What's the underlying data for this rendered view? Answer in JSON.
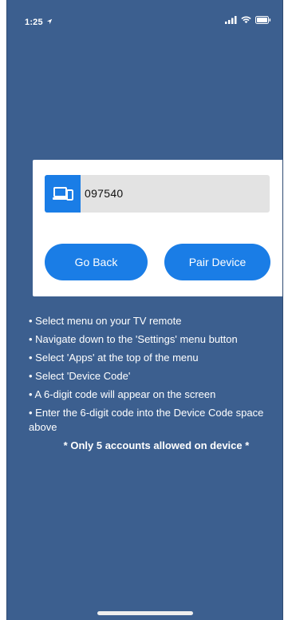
{
  "status_bar": {
    "time": "1:25",
    "location_icon": "location-arrow-icon",
    "signal_icon": "signal-bars-icon",
    "wifi_icon": "wifi-icon",
    "battery_icon": "battery-icon"
  },
  "pair_card": {
    "device_icon": "tv-device-icon",
    "device_code": "097540",
    "back_label": "Go Back",
    "pair_label": "Pair Device"
  },
  "instructions": {
    "items": [
      "• Select menu on your TV remote",
      "• Navigate down to the 'Settings' menu button",
      "• Select 'Apps' at the top of the menu",
      "• Select 'Device Code'",
      "• A 6-digit code will appear on the screen",
      "• Enter the 6-digit code into the Device Code space above"
    ],
    "note": "* Only 5 accounts allowed on device *"
  },
  "colors": {
    "background": "#3c5f8f",
    "accent": "#1a7de6",
    "card": "#ffffff",
    "code_field": "#e3e3e3"
  }
}
